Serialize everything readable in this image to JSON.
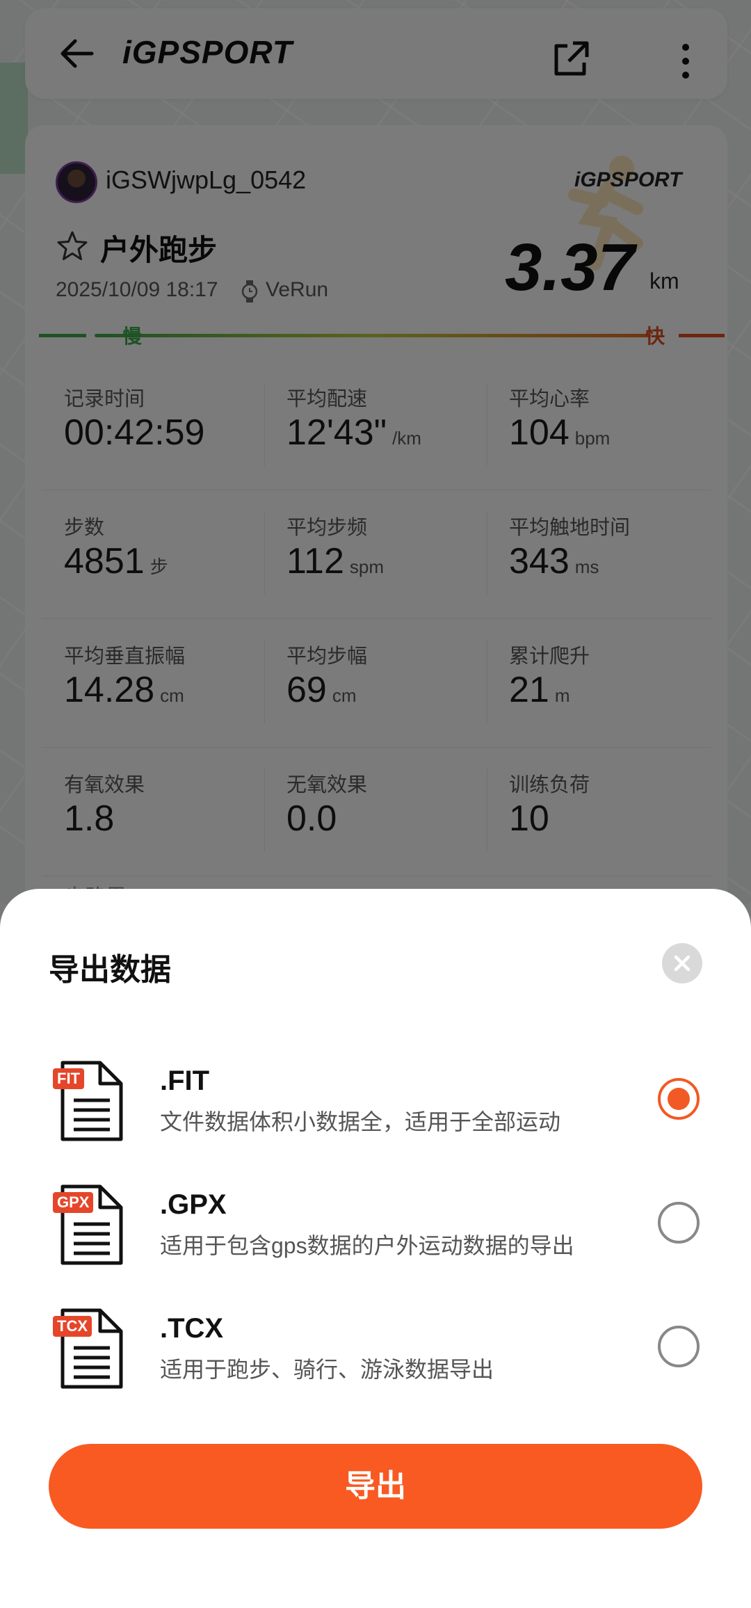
{
  "header": {
    "brand": "iGPSPORT"
  },
  "activity": {
    "username": "iGSWjwpLg_0542",
    "brand": "iGPSPORT",
    "sport": "户外跑步",
    "datetime": "2025/10/09 18:17",
    "device": "VeRun",
    "distance": "3.37",
    "distance_unit": "km",
    "slow_label": "慢",
    "fast_label": "快"
  },
  "stats": [
    [
      {
        "label": "记录时间",
        "value": "00:42:59",
        "unit": ""
      },
      {
        "label": "平均配速",
        "value": "12'43\"",
        "unit": "/km"
      },
      {
        "label": "平均心率",
        "value": "104",
        "unit": "bpm"
      }
    ],
    [
      {
        "label": "步数",
        "value": "4851",
        "unit": "步"
      },
      {
        "label": "平均步频",
        "value": "112",
        "unit": "spm"
      },
      {
        "label": "平均触地时间",
        "value": "343",
        "unit": "ms"
      }
    ],
    [
      {
        "label": "平均垂直振幅",
        "value": "14.28",
        "unit": "cm"
      },
      {
        "label": "平均步幅",
        "value": "69",
        "unit": "cm"
      },
      {
        "label": "累计爬升",
        "value": "21",
        "unit": "m"
      }
    ],
    [
      {
        "label": "有氧效果",
        "value": "1.8",
        "unit": ""
      },
      {
        "label": "无氧效果",
        "value": "0.0",
        "unit": ""
      },
      {
        "label": "训练负荷",
        "value": "10",
        "unit": ""
      }
    ]
  ],
  "partial_label": "步路里",
  "sheet": {
    "title": "导出数据",
    "options": [
      {
        "badge": "FIT",
        "name": ".FIT",
        "desc": "文件数据体积小数据全，适用于全部运动",
        "selected": true
      },
      {
        "badge": "GPX",
        "name": ".GPX",
        "desc": "适用于包含gps数据的户外运动数据的导出",
        "selected": false
      },
      {
        "badge": "TCX",
        "name": ".TCX",
        "desc": "适用于跑步、骑行、游泳数据导出",
        "selected": false
      }
    ],
    "export_label": "导出"
  },
  "colors": {
    "accent": "#f85a22",
    "radio_selected": "#f15a24",
    "badge": "#e5462a",
    "slow": "#3aa54a",
    "fast": "#d94a1f"
  }
}
